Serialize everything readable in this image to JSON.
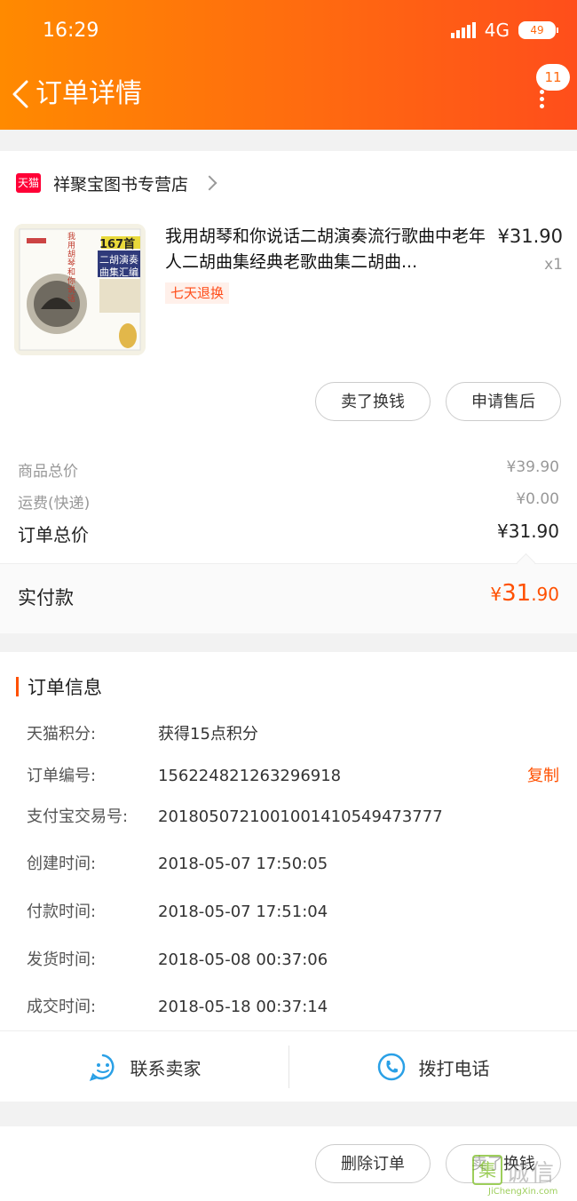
{
  "status_bar": {
    "time": "16:29",
    "network": "4G",
    "battery": "49"
  },
  "header": {
    "title": "订单详情",
    "badge_count": "11"
  },
  "shop": {
    "platform_tag": "天猫",
    "name": "祥聚宝图书专营店"
  },
  "product": {
    "title": "我用胡琴和你说话二胡演奏流行歌曲中老年人二胡曲集经典老歌曲集二胡曲...",
    "unit_price": "¥31.90",
    "quantity": "x1",
    "return_tag": "七天退换",
    "cover_text": {
      "count": "167首",
      "line1": "二胡演奏",
      "line2": "曲集汇编",
      "side": "我用胡琴和你说话"
    },
    "actions": {
      "sell": "卖了换钱",
      "after_sale": "申请售后"
    }
  },
  "pricing": {
    "goods_label": "商品总价",
    "goods_value": "¥39.90",
    "shipping_label": "运费(快递)",
    "shipping_value": "¥0.00",
    "order_total_label": "订单总价",
    "order_total_value": "¥31.90",
    "paid_label": "实付款",
    "paid_currency": "¥",
    "paid_int": "31",
    "paid_dec": ".90"
  },
  "order_info": {
    "title": "订单信息",
    "rows": [
      {
        "label": "天猫积分:",
        "value": "获得15点积分"
      },
      {
        "label": "订单编号:",
        "value": "156224821263296918",
        "action": "复制"
      },
      {
        "label": "支付宝交易号:",
        "value": "2018050721001001410549473777"
      },
      {
        "label": "创建时间:",
        "value": "2018-05-07 17:50:05"
      },
      {
        "label": "付款时间:",
        "value": "2018-05-07 17:51:04"
      },
      {
        "label": "发货时间:",
        "value": "2018-05-08 00:37:06"
      },
      {
        "label": "成交时间:",
        "value": "2018-05-18 00:37:14"
      }
    ],
    "contact_seller": "联系卖家",
    "call_phone": "拨打电话"
  },
  "bottom_actions": {
    "delete": "删除订单",
    "sell": "卖了换钱"
  },
  "watermark": {
    "glyph": "集",
    "text": "诚信",
    "url": "JiChengXin.com"
  },
  "colors": {
    "accent": "#ff5000",
    "header_start": "#ff8a00",
    "header_end": "#ff4e1b",
    "tmall_red": "#ff0036",
    "icon_blue": "#2aa0e6"
  }
}
